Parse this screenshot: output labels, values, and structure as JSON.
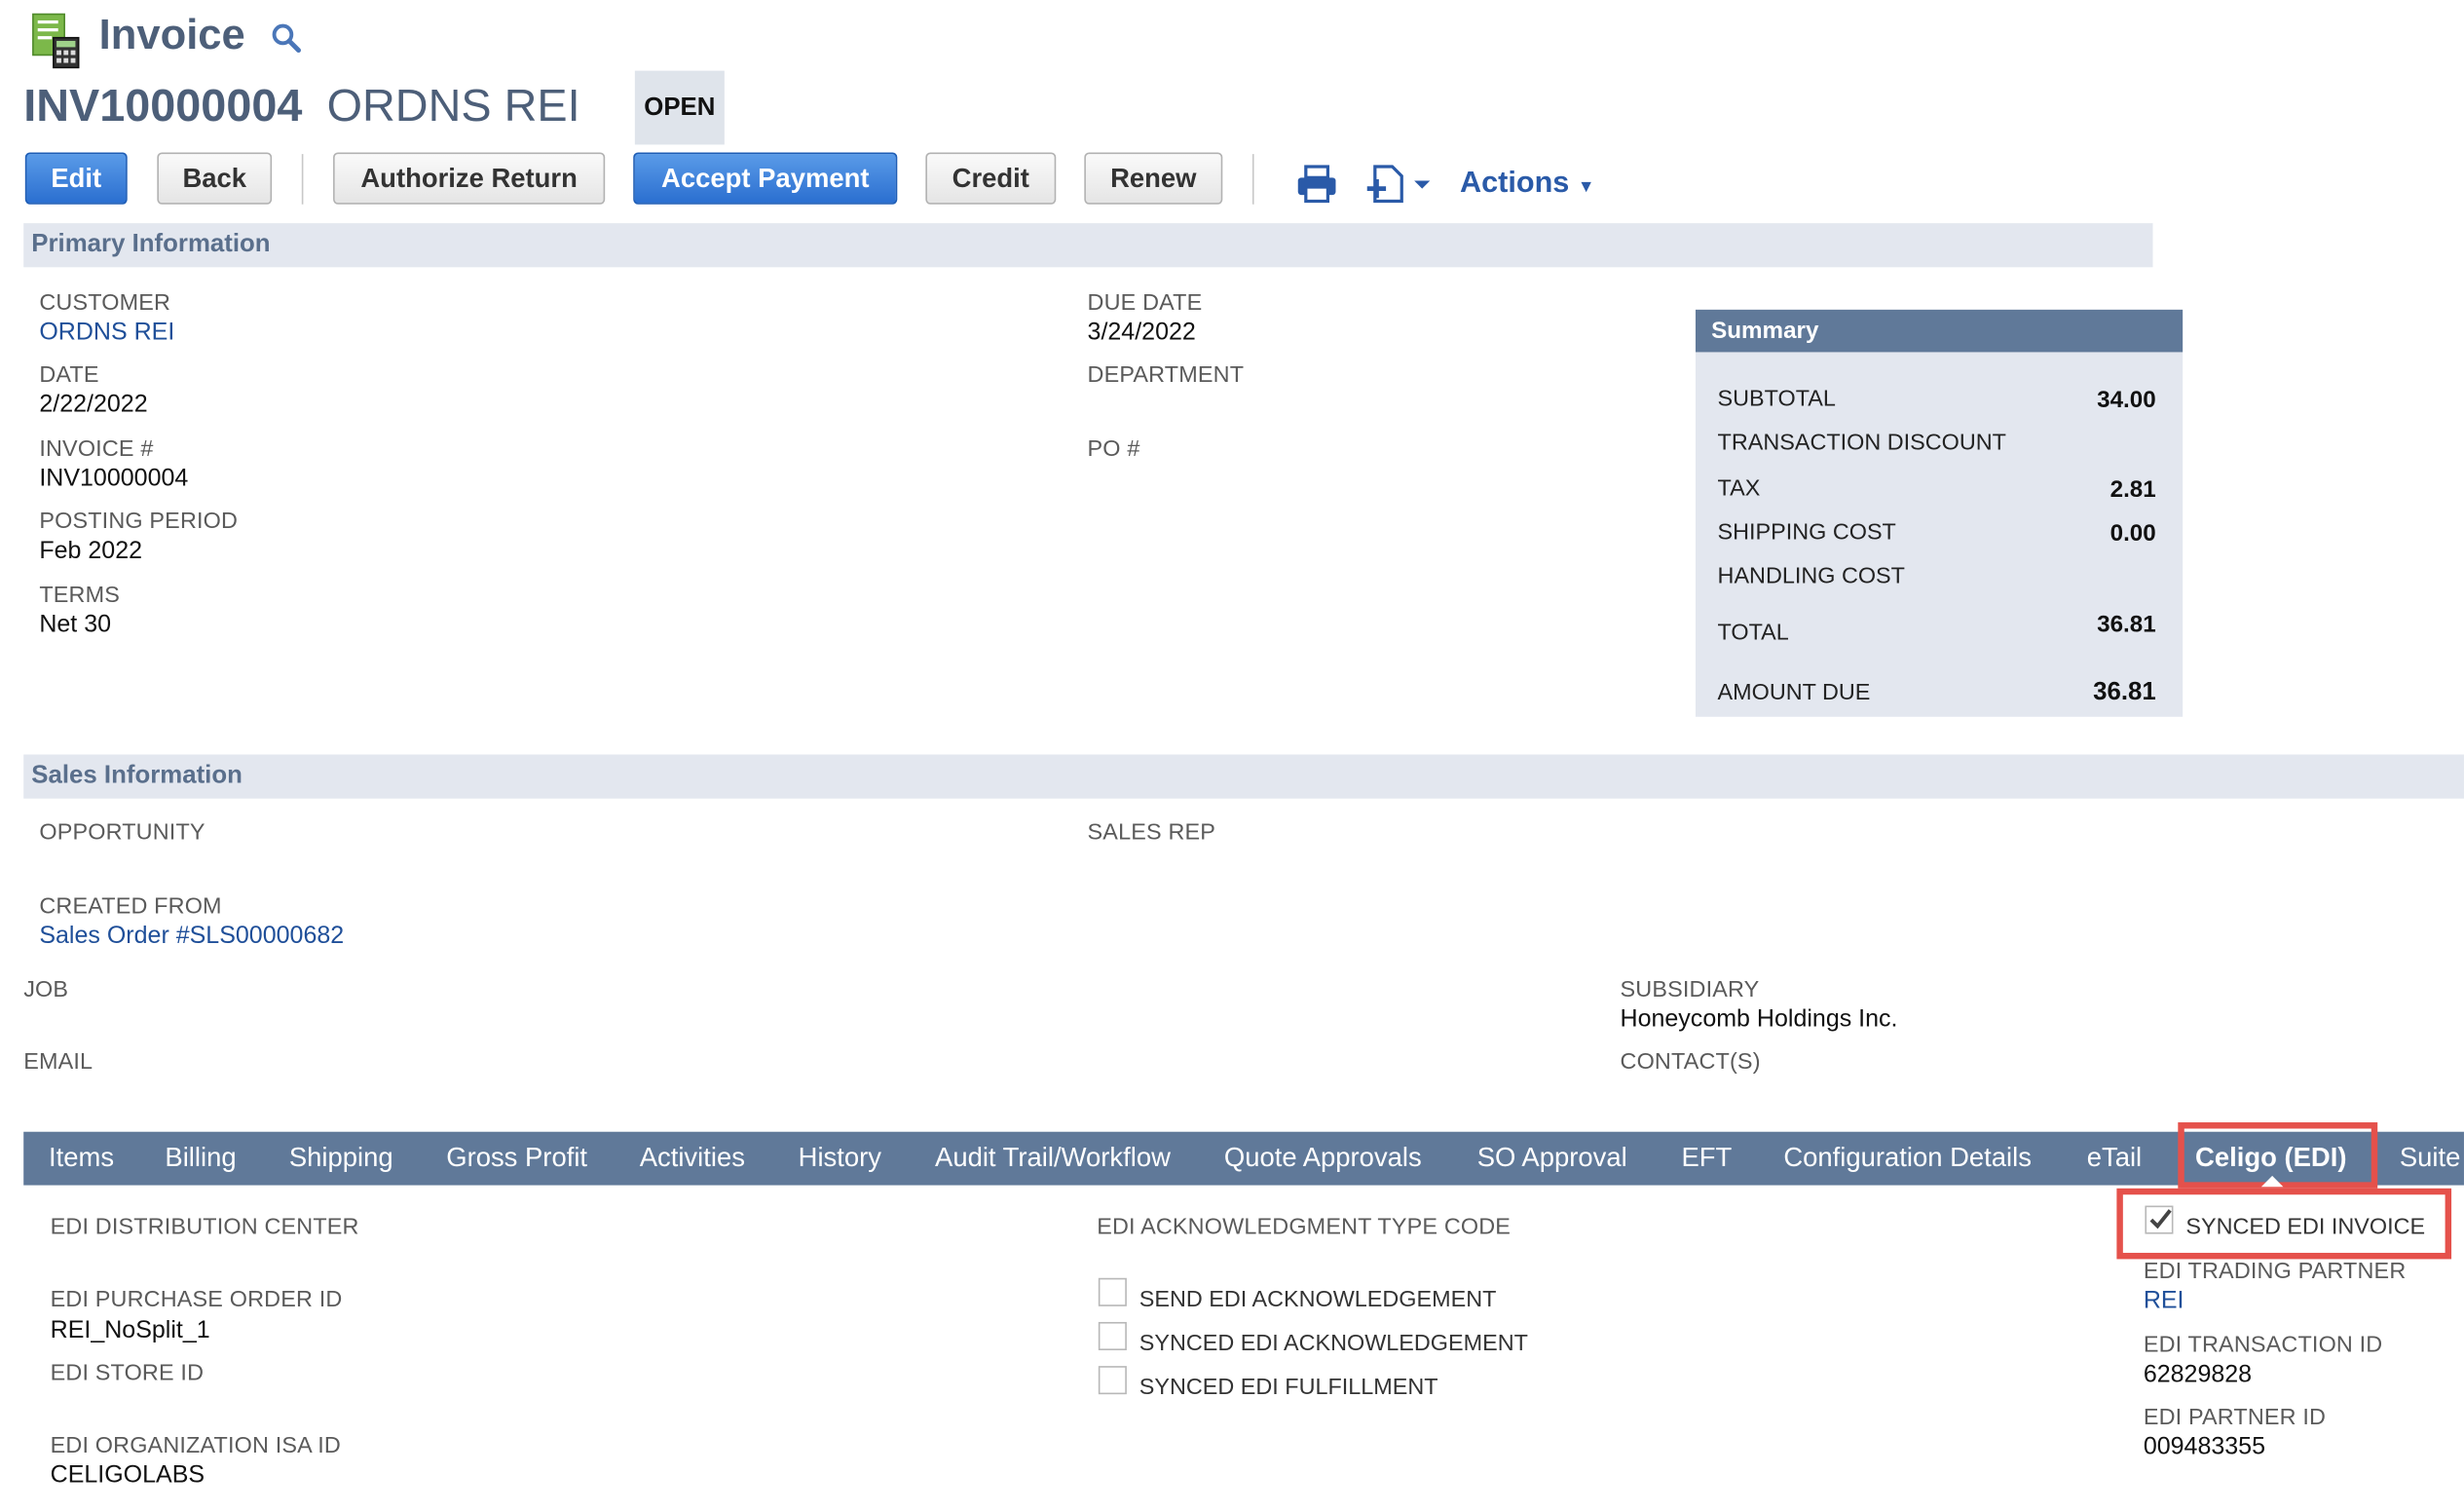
{
  "header": {
    "record_type": "Invoice",
    "record_id": "INV10000004",
    "customer_name": "ORDNS REI",
    "status": "OPEN"
  },
  "toolbar": {
    "edit": "Edit",
    "back": "Back",
    "authorize_return": "Authorize Return",
    "accept_payment": "Accept Payment",
    "credit": "Credit",
    "renew": "Renew",
    "actions": "Actions"
  },
  "primary": {
    "section_title": "Primary Information",
    "customer_label": "CUSTOMER",
    "customer_value": "ORDNS REI",
    "date_label": "DATE",
    "date_value": "2/22/2022",
    "invoice_label": "INVOICE #",
    "invoice_value": "INV10000004",
    "posting_label": "POSTING PERIOD",
    "posting_value": "Feb 2022",
    "terms_label": "TERMS",
    "terms_value": "Net 30",
    "due_label": "DUE DATE",
    "due_value": "3/24/2022",
    "department_label": "DEPARTMENT",
    "po_label": "PO #"
  },
  "summary": {
    "title": "Summary",
    "subtotal_label": "SUBTOTAL",
    "subtotal_value": "34.00",
    "discount_label": "TRANSACTION DISCOUNT",
    "tax_label": "TAX",
    "tax_value": "2.81",
    "shipping_label": "SHIPPING COST",
    "shipping_value": "0.00",
    "handling_label": "HANDLING COST",
    "total_label": "TOTAL",
    "total_value": "36.81",
    "due_label": "AMOUNT DUE",
    "due_value": "36.81"
  },
  "sales": {
    "section_title": "Sales Information",
    "opportunity_label": "OPPORTUNITY",
    "sales_rep_label": "SALES REP",
    "created_from_label": "CREATED FROM",
    "created_from_value": "Sales Order #SLS00000682",
    "job_label": "JOB",
    "subsidiary_label": "SUBSIDIARY",
    "subsidiary_value": "Honeycomb Holdings Inc.",
    "email_label": "EMAIL",
    "contacts_label": "CONTACT(S)"
  },
  "tabs": [
    "Items",
    "Billing",
    "Shipping",
    "Gross Profit",
    "Activities",
    "History",
    "Audit Trail/Workflow",
    "Quote Approvals",
    "SO Approval",
    "EFT",
    "Configuration Details",
    "eTail",
    "Celigo (EDI)",
    "Suite"
  ],
  "edi": {
    "distribution_center_label": "EDI DISTRIBUTION CENTER",
    "po_id_label": "EDI PURCHASE ORDER ID",
    "po_id_value": "REI_NoSplit_1",
    "store_id_label": "EDI STORE ID",
    "org_isa_label": "EDI ORGANIZATION ISA ID",
    "org_isa_value": "CELIGOLABS",
    "ack_type_label": "EDI ACKNOWLEDGMENT TYPE CODE",
    "send_ack_label": "SEND EDI ACKNOWLEDGEMENT",
    "synced_ack_label": "SYNCED EDI ACKNOWLEDGEMENT",
    "synced_fulfillment_label": "SYNCED EDI FULFILLMENT",
    "synced_invoice_label": "SYNCED EDI INVOICE",
    "trading_partner_label": "EDI TRADING PARTNER",
    "trading_partner_value": "REI",
    "transaction_id_label": "EDI TRANSACTION ID",
    "transaction_id_value": "62829828",
    "partner_id_label": "EDI PARTNER ID",
    "partner_id_value": "009483355"
  },
  "colors": {
    "accent_blue": "#2b6fd0",
    "header_slate": "#4d5f79",
    "tab_bar": "#607999",
    "highlight_red": "#e5514b"
  }
}
